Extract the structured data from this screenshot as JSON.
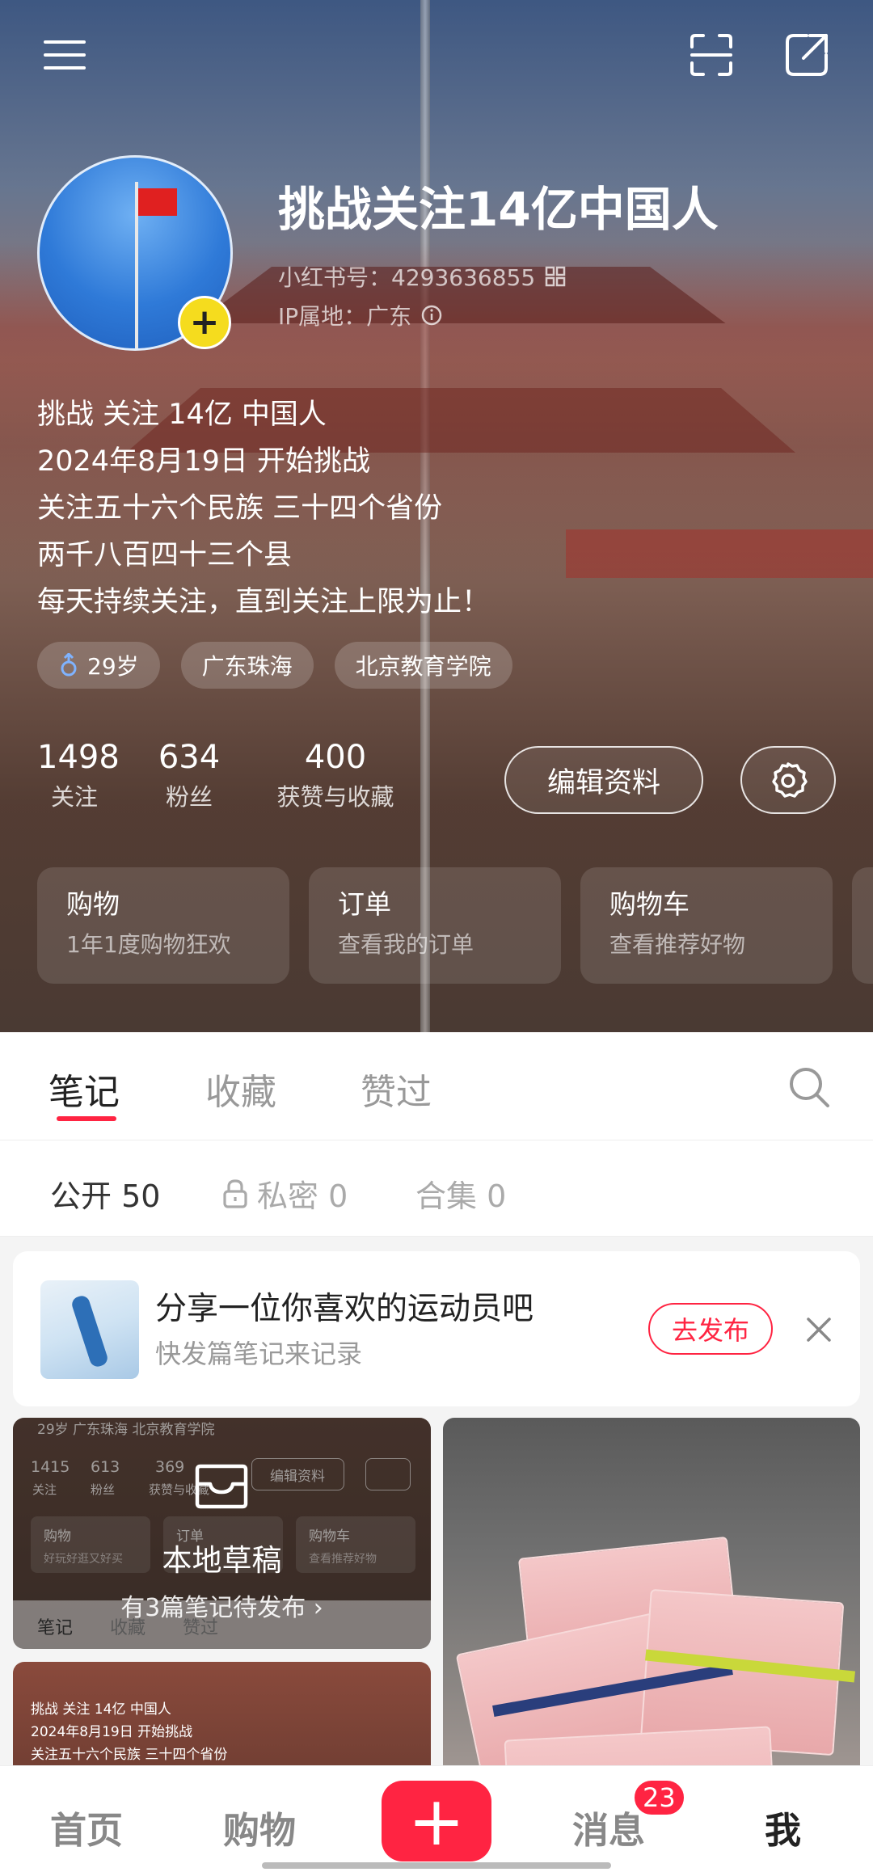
{
  "profile": {
    "nickname": "挑战关注14亿中国人",
    "id_text": "小红书号：4293636855",
    "ip_text": "IP属地：广东",
    "bio": [
      "挑战 关注 14亿 中国人",
      "2024年8月19日 开始挑战",
      "关注五十六个民族 三十四个省份",
      "两千八百四十三个县",
      "每天持续关注，直到关注上限为止！"
    ],
    "tags": [
      "29岁",
      "广东珠海",
      "北京教育学院"
    ],
    "stats": [
      {
        "num": "1498",
        "label": "关注"
      },
      {
        "num": "634",
        "label": "粉丝"
      },
      {
        "num": "400",
        "label": "获赞与收藏"
      }
    ],
    "edit_label": "编辑资料"
  },
  "cards": [
    {
      "title": "购物",
      "sub": "1年1度购物狂欢"
    },
    {
      "title": "订单",
      "sub": "查看我的订单"
    },
    {
      "title": "购物车",
      "sub": "查看推荐好物"
    }
  ],
  "tabs": [
    "笔记",
    "收藏",
    "赞过"
  ],
  "subtabs": [
    "公开 50",
    "私密 0",
    "合集 0"
  ],
  "promo": {
    "title": "分享一位你喜欢的运动员吧",
    "sub": "快发篇笔记来记录",
    "button": "去发布"
  },
  "drafts": {
    "title": "本地草稿",
    "sub": "有3篇笔记待发布 ›",
    "preview": {
      "tags": "29岁   广东珠海   北京教育学院",
      "stats_nums": [
        "1415",
        "613",
        "369"
      ],
      "stats_labels": [
        "关注",
        "粉丝",
        "获赞与收藏"
      ],
      "edit": "编辑资料",
      "cards": [
        "购物",
        "订单",
        "购物车"
      ],
      "card_subs": [
        "好玩好逛又好买",
        "查看推荐好物"
      ],
      "tabs": [
        "笔记",
        "收藏",
        "赞过"
      ]
    }
  },
  "preview2_lines": [
    "挑战 关注 14亿 中国人",
    "2024年8月19日 开始挑战",
    "关注五十六个民族 三十四个省份"
  ],
  "bottom_nav": {
    "home": "首页",
    "shop": "购物",
    "plus": "+",
    "messages": "消息",
    "me": "我",
    "badge": "23"
  },
  "colors": {
    "accent": "#ff2442",
    "avatar_add": "#f5dc1e"
  }
}
